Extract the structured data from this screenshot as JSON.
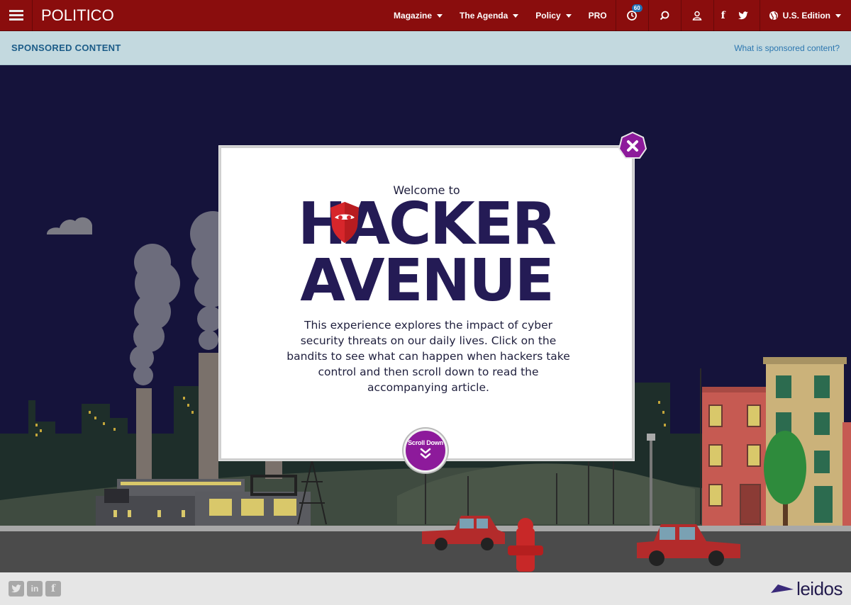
{
  "header": {
    "logo": "POLITICO",
    "nav": [
      {
        "label": "Magazine"
      },
      {
        "label": "The Agenda"
      },
      {
        "label": "Policy"
      },
      {
        "label": "PRO"
      }
    ],
    "notification_count": "60",
    "edition": "U.S. Edition"
  },
  "sponsored_bar": {
    "label": "SPONSORED CONTENT",
    "link": "What is sponsored content?"
  },
  "modal": {
    "welcome": "Welcome to",
    "title_line1": "HACKER",
    "title_line2": "AVENUE",
    "description": "This experience explores the impact of cyber security threats on our daily lives. Click on the bandits to see what can happen when hackers take control and then scroll down to read the accompanying article.",
    "scroll_label": "Scroll Down"
  },
  "footer": {
    "social": [
      "twitter-icon",
      "linkedin-icon",
      "facebook-icon"
    ],
    "brand": "leidos"
  },
  "colors": {
    "header_bg": "#8a0d0d",
    "sponsored_bg": "#c3d9df",
    "night_sky": "#15133b",
    "title": "#241b55",
    "accent_purple": "#8d1a9b",
    "shield_red": "#d7262b"
  }
}
